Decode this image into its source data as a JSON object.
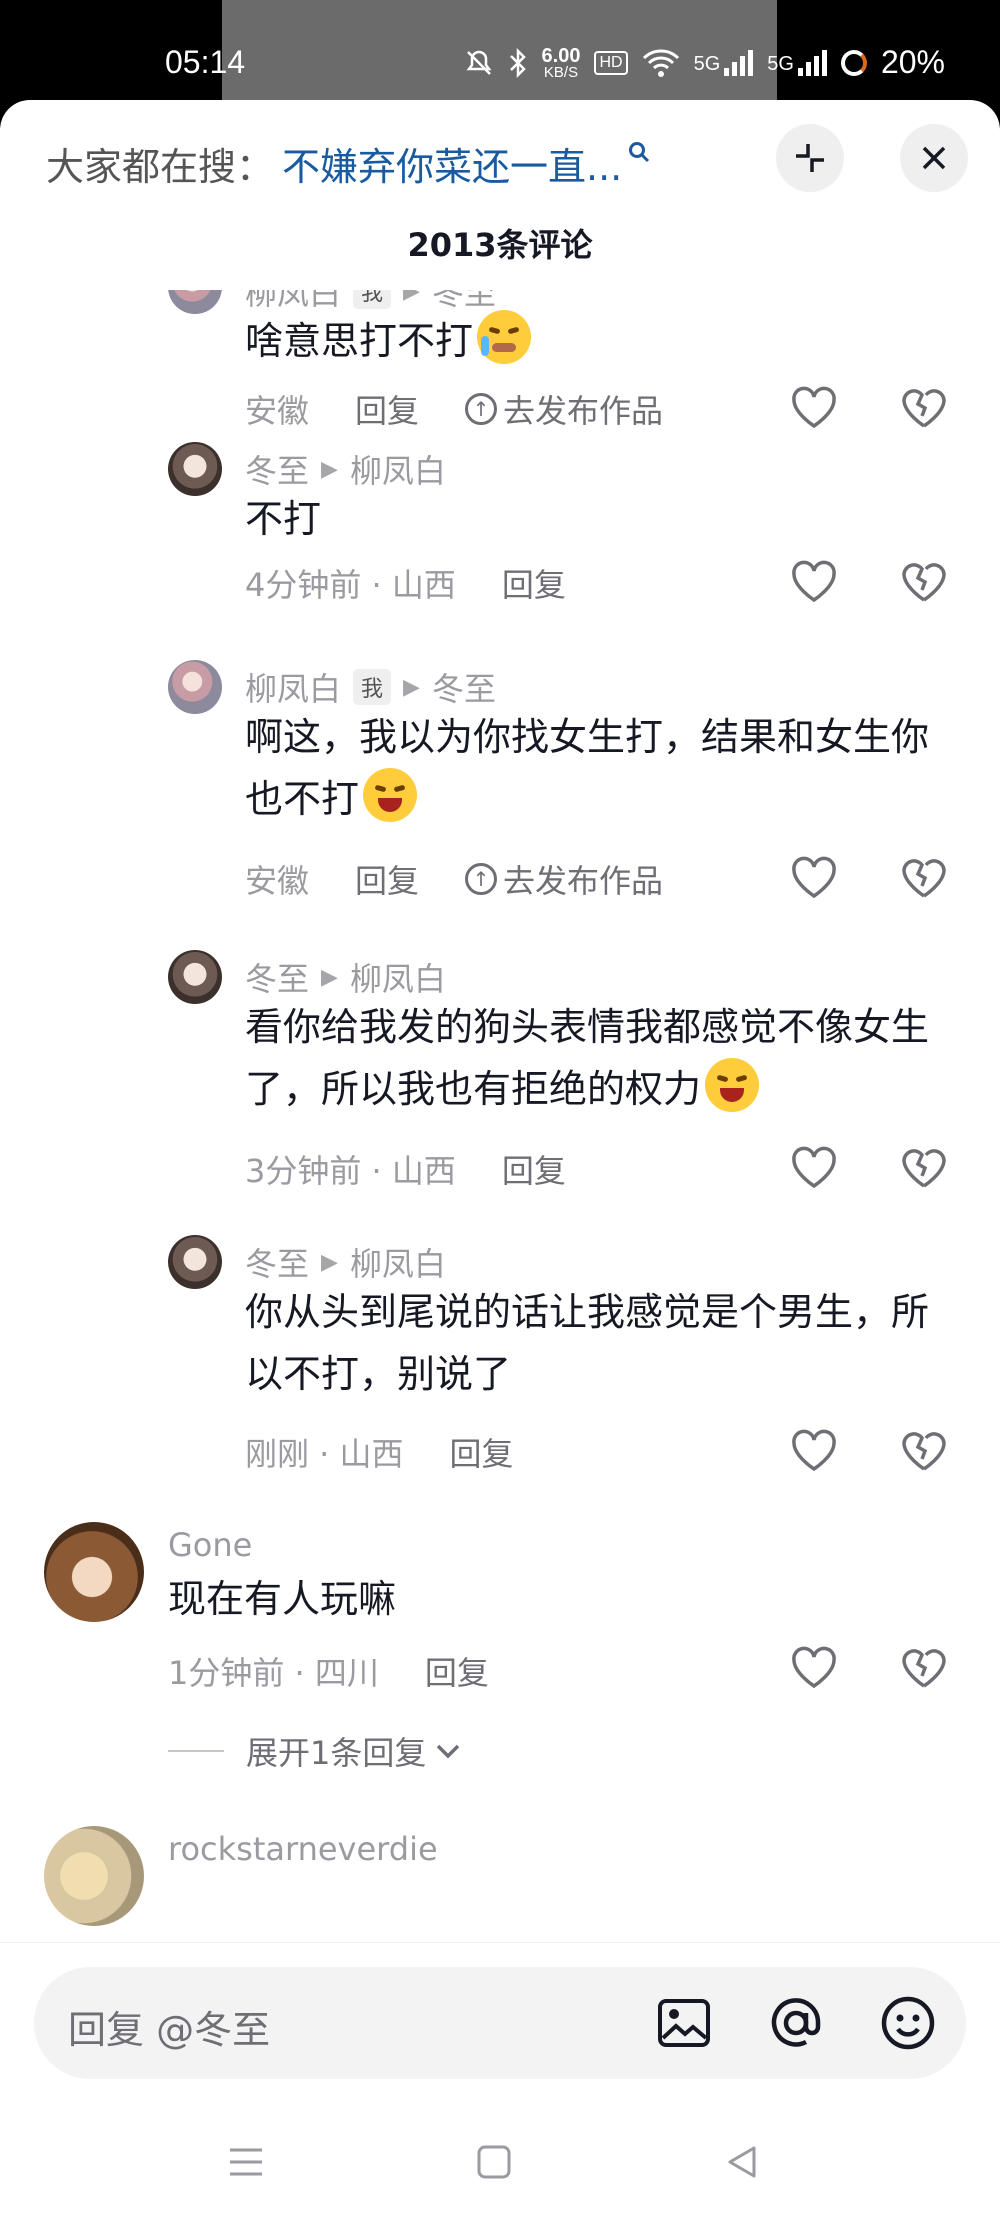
{
  "status": {
    "time": "05:14",
    "speed_value": "6.00",
    "speed_unit": "KB/S",
    "hd": "HD",
    "net1": "5G",
    "net2": "5G",
    "battery": "20%"
  },
  "header": {
    "search_label": "大家都在搜：",
    "search_query": "不嫌弃你菜还一直...",
    "comment_count": "2013条评论"
  },
  "comments": [
    {
      "name": "柳凤白",
      "tag": "我",
      "reply_to": "冬至",
      "text": "啥意思打不打",
      "location": "安徽",
      "reply": "回复",
      "publish": "去发布作品"
    },
    {
      "name": "冬至",
      "reply_to": "柳凤白",
      "text": "不打",
      "meta": "4分钟前 · 山西",
      "reply": "回复"
    },
    {
      "name": "柳凤白",
      "tag": "我",
      "reply_to": "冬至",
      "text": "啊这，我以为你找女生打，结果和女生你也不打",
      "location": "安徽",
      "reply": "回复",
      "publish": "去发布作品"
    },
    {
      "name": "冬至",
      "reply_to": "柳凤白",
      "text": "看你给我发的狗头表情我都感觉不像女生了，所以我也有拒绝的权力",
      "meta": "3分钟前 · 山西",
      "reply": "回复"
    },
    {
      "name": "冬至",
      "reply_to": "柳凤白",
      "text": "你从头到尾说的话让我感觉是个男生，所以不打，别说了",
      "meta": "刚刚 · 山西",
      "reply": "回复"
    },
    {
      "name": "Gone",
      "text": "现在有人玩嘛",
      "meta": "1分钟前 · 四川",
      "reply": "回复",
      "expand": "展开1条回复"
    },
    {
      "name": "rockstarneverdie"
    }
  ],
  "input": {
    "placeholder": "回复 @冬至"
  }
}
